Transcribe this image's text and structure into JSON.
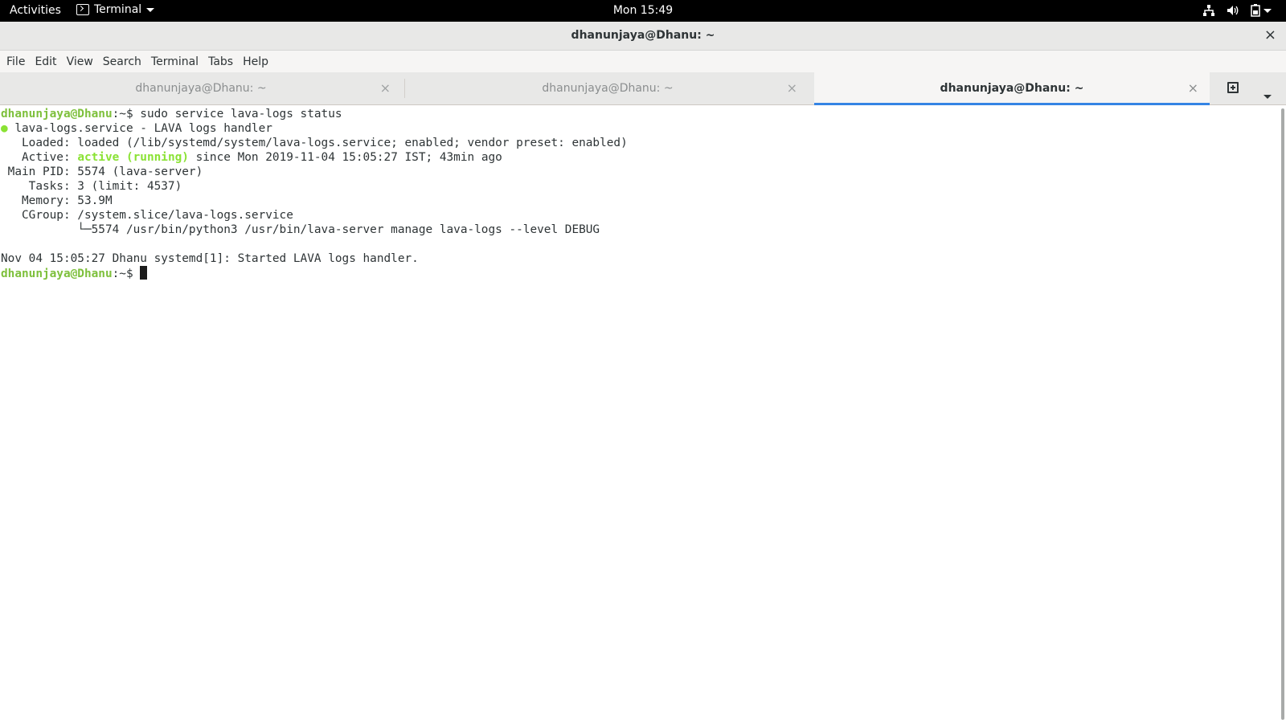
{
  "topbar": {
    "activities": "Activities",
    "app_name": "Terminal",
    "clock": "Mon 15:49",
    "tray_icons": [
      "network-icon",
      "volume-icon",
      "battery-icon",
      "system-menu-caret"
    ]
  },
  "window": {
    "title": "dhanunjaya@Dhanu: ~",
    "close": "×"
  },
  "menubar": {
    "items": [
      "File",
      "Edit",
      "View",
      "Search",
      "Terminal",
      "Tabs",
      "Help"
    ]
  },
  "tabs": [
    {
      "label": "dhanunjaya@Dhanu: ~",
      "close": "×",
      "active": false
    },
    {
      "label": "dhanunjaya@Dhanu: ~",
      "close": "×",
      "active": false
    },
    {
      "label": "dhanunjaya@Dhanu: ~",
      "close": "×",
      "active": true
    }
  ],
  "terminal": {
    "prompt_user": "dhanunjaya@Dhanu",
    "prompt_path": ":~$ ",
    "command": "sudo service lava-logs status",
    "status_dot": "●",
    "service_line": " lava-logs.service - LAVA logs handler",
    "loaded": "   Loaded: loaded (/lib/systemd/system/lava-logs.service; enabled; vendor preset: enabled)",
    "active_label": "   Active: ",
    "active_state": "active (running)",
    "active_rest": " since Mon 2019-11-04 15:05:27 IST; 43min ago",
    "main_pid": " Main PID: 5574 (lava-server)",
    "tasks": "    Tasks: 3 (limit: 4537)",
    "memory": "   Memory: 53.9M",
    "cgroup": "   CGroup: /system.slice/lava-logs.service",
    "cgroup_child": "           └─5574 /usr/bin/python3 /usr/bin/lava-server manage lava-logs --level DEBUG",
    "log_line": "Nov 04 15:05:27 Dhanu systemd[1]: Started LAVA logs handler.",
    "colors": {
      "prompt": "#7ec03c",
      "active": "#8ae234",
      "text": "#2e3436"
    }
  }
}
